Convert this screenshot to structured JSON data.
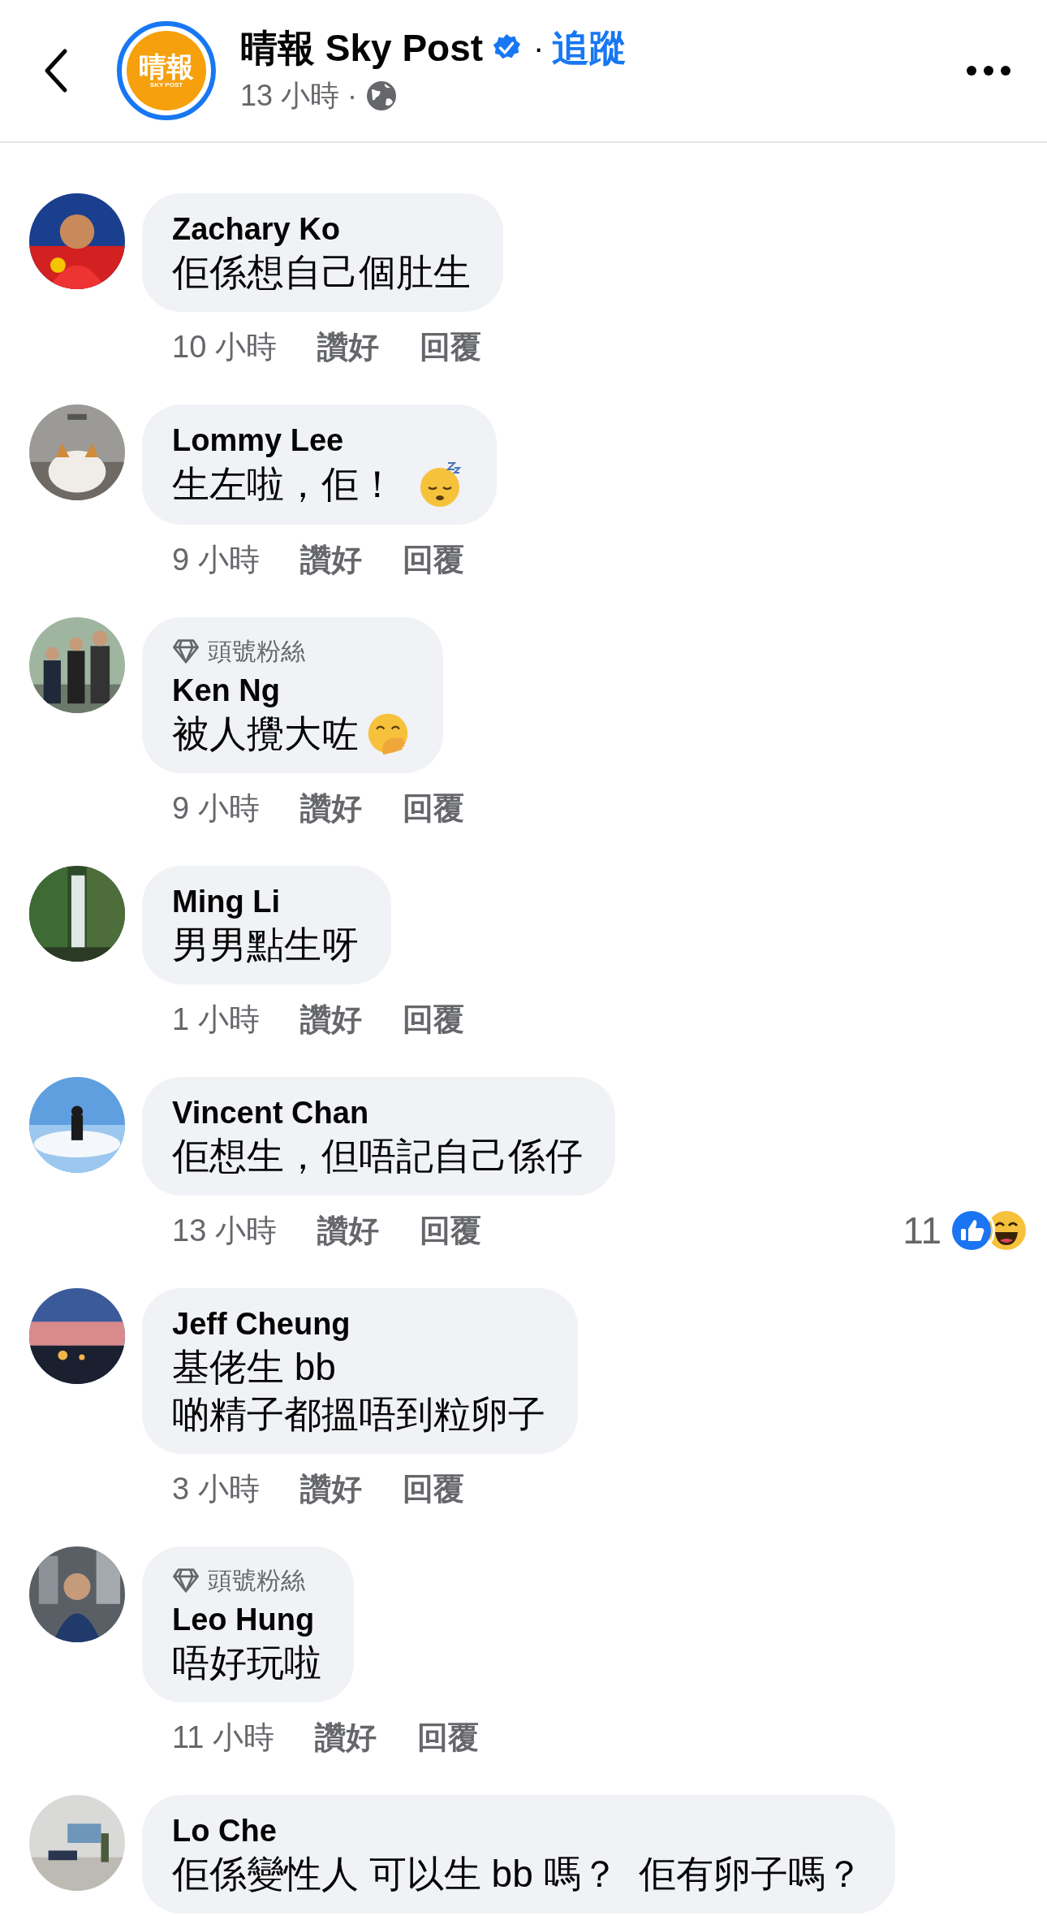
{
  "header": {
    "logo_text": "晴報",
    "logo_subtext": "SKY POST",
    "page_name": "晴報 Sky Post",
    "verified": true,
    "separator": "·",
    "follow": "追蹤",
    "time": "13 小時",
    "time_separator": "·"
  },
  "comments": [
    {
      "author": "Zachary Ko",
      "lines": [
        "佢係想自己個肚生"
      ],
      "time": "10 小時",
      "like": "讚好",
      "reply": "回覆"
    },
    {
      "author": "Lommy Lee",
      "lines": [
        "生左啦，佢！"
      ],
      "emoji": {
        "kind": "sleepy"
      },
      "time": "9 小時",
      "like": "讚好",
      "reply": "回覆"
    },
    {
      "author": "Ken Ng",
      "badge": "頭號粉絲",
      "lines": [
        "被人攪大咗"
      ],
      "emoji": {
        "kind": "blush"
      },
      "time": "9 小時",
      "like": "讚好",
      "reply": "回覆"
    },
    {
      "author": "Ming Li",
      "lines": [
        "男男點生呀"
      ],
      "time": "1 小時",
      "like": "讚好",
      "reply": "回覆"
    },
    {
      "author": "Vincent Chan",
      "lines": [
        "佢想生，但唔記自己係仔"
      ],
      "time": "13 小時",
      "like": "讚好",
      "reply": "回覆",
      "reactions": {
        "count": "11",
        "items": [
          {
            "kind": "like"
          },
          {
            "kind": "haha"
          }
        ]
      }
    },
    {
      "author": "Jeff Cheung",
      "lines": [
        "基佬生 bb",
        "啲精子都搵唔到粒卵子"
      ],
      "time": "3 小時",
      "like": "讚好",
      "reply": "回覆"
    },
    {
      "author": "Leo Hung",
      "badge": "頭號粉絲",
      "lines": [
        "唔好玩啦"
      ],
      "time": "11 小時",
      "like": "讚好",
      "reply": "回覆"
    },
    {
      "author": "Lo Che",
      "lines": [
        "佢係變性人 可以生 bb 嗎？  佢有卵子嗎？"
      ]
    }
  ]
}
